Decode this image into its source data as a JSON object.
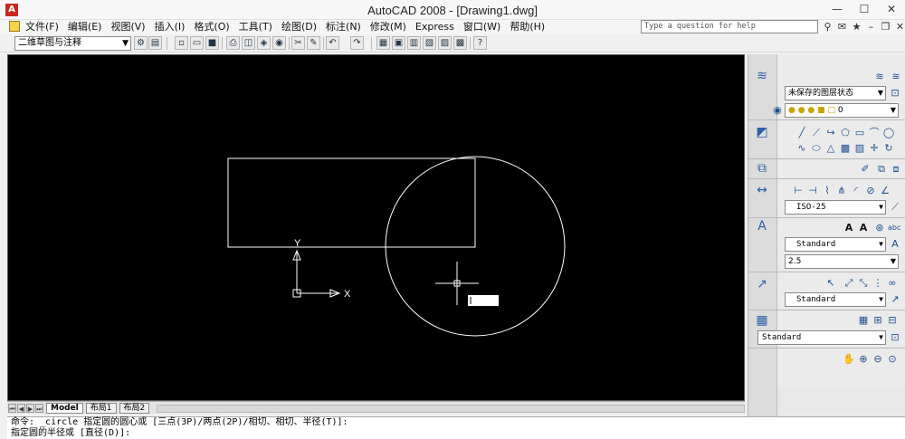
{
  "window": {
    "title": "AutoCAD 2008 - [Drawing1.dwg]",
    "controls": [
      "—",
      "☐",
      "✕"
    ]
  },
  "menu": {
    "items": [
      "文件(F)",
      "编辑(E)",
      "视图(V)",
      "插入(I)",
      "格式(O)",
      "工具(T)",
      "绘图(D)",
      "标注(N)",
      "修改(M)",
      "Express",
      "窗口(W)",
      "帮助(H)"
    ]
  },
  "help": {
    "placeholder": "Type a question for help"
  },
  "toolbar": {
    "workspace": "二维草图与注释"
  },
  "canvas": {
    "ucs_x_label": "X",
    "ucs_y_label": "Y",
    "input_value": ""
  },
  "layout_tabs": {
    "model": "Model",
    "layout1": "布局1",
    "layout2": "布局2"
  },
  "command": {
    "line1": "命令:  _circle 指定圆的圆心或 [三点(3P)/两点(2P)/相切、相切、半径(T)]:",
    "line2": "指定圆的半径或 [直径(D)]:"
  },
  "palette": {
    "layer_state": "未保存的图层状态",
    "layer_current": "0",
    "dim_style": "ISO-25",
    "text_style": "Standard",
    "text_height": "2.5",
    "mleader_style": "Standard",
    "table_style": "Standard"
  },
  "colors": {
    "canvas_bg": "#000000",
    "geometry_stroke": "#ffffff"
  }
}
